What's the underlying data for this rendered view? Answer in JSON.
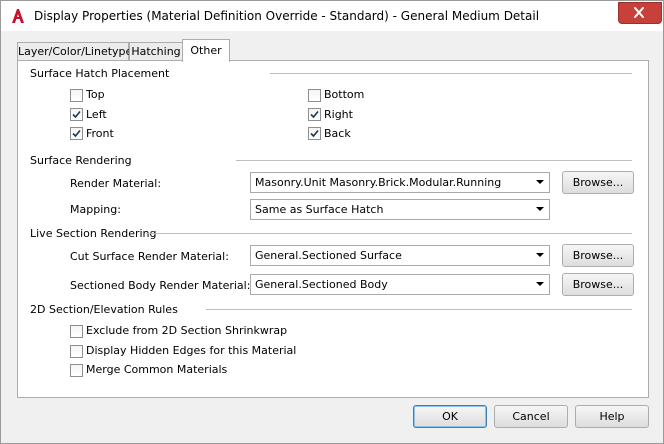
{
  "window": {
    "title": "Display Properties (Material Definition Override - Standard) - General Medium Detail",
    "app_icon": "autocad-a-icon",
    "close_icon": "close-icon"
  },
  "tabs": [
    {
      "label": "Layer/Color/Linetype",
      "active": false
    },
    {
      "label": "Hatching",
      "active": false
    },
    {
      "label": "Other",
      "active": true
    }
  ],
  "surface_hatch": {
    "heading": "Surface Hatch Placement",
    "top": {
      "label": "Top",
      "checked": false
    },
    "bottom": {
      "label": "Bottom",
      "checked": false
    },
    "left": {
      "label": "Left",
      "checked": true
    },
    "right": {
      "label": "Right",
      "checked": true
    },
    "front": {
      "label": "Front",
      "checked": true
    },
    "back": {
      "label": "Back",
      "checked": true
    }
  },
  "surface_rendering": {
    "heading": "Surface Rendering",
    "render_material_label": "Render Material:",
    "render_material_value": "Masonry.Unit Masonry.Brick.Modular.Running",
    "browse_label": "Browse...",
    "mapping_label": "Mapping:",
    "mapping_value": "Same as Surface Hatch"
  },
  "live_section": {
    "heading": "Live Section Rendering",
    "cut_surface_label": "Cut Surface Render Material:",
    "cut_surface_value": "General.Sectioned Surface",
    "cut_browse_label": "Browse...",
    "sectioned_body_label": "Sectioned Body Render Material:",
    "sectioned_body_value": "General.Sectioned Body",
    "body_browse_label": "Browse..."
  },
  "section_rules": {
    "heading": "2D Section/Elevation Rules",
    "exclude": {
      "label": "Exclude from 2D Section Shrinkwrap",
      "checked": false
    },
    "display_hidden": {
      "label": "Display Hidden Edges for this Material",
      "checked": false
    },
    "merge": {
      "label": "Merge Common Materials",
      "checked": false
    }
  },
  "footer": {
    "ok_label": "OK",
    "cancel_label": "Cancel",
    "help_label": "Help"
  },
  "colors": {
    "close_button": "#c7413a",
    "default_button_border": "#3c7fb1",
    "app_icon_red": "#c8102e"
  }
}
